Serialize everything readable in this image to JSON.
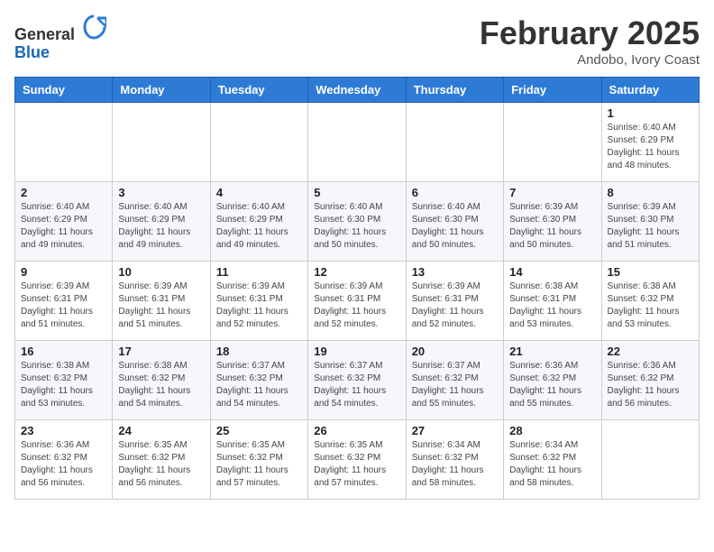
{
  "header": {
    "logo_general": "General",
    "logo_blue": "Blue",
    "month_title": "February 2025",
    "location": "Andobo, Ivory Coast"
  },
  "weekdays": [
    "Sunday",
    "Monday",
    "Tuesday",
    "Wednesday",
    "Thursday",
    "Friday",
    "Saturday"
  ],
  "weeks": [
    [
      {
        "day": "",
        "info": ""
      },
      {
        "day": "",
        "info": ""
      },
      {
        "day": "",
        "info": ""
      },
      {
        "day": "",
        "info": ""
      },
      {
        "day": "",
        "info": ""
      },
      {
        "day": "",
        "info": ""
      },
      {
        "day": "1",
        "info": "Sunrise: 6:40 AM\nSunset: 6:29 PM\nDaylight: 11 hours\nand 48 minutes."
      }
    ],
    [
      {
        "day": "2",
        "info": "Sunrise: 6:40 AM\nSunset: 6:29 PM\nDaylight: 11 hours\nand 49 minutes."
      },
      {
        "day": "3",
        "info": "Sunrise: 6:40 AM\nSunset: 6:29 PM\nDaylight: 11 hours\nand 49 minutes."
      },
      {
        "day": "4",
        "info": "Sunrise: 6:40 AM\nSunset: 6:29 PM\nDaylight: 11 hours\nand 49 minutes."
      },
      {
        "day": "5",
        "info": "Sunrise: 6:40 AM\nSunset: 6:30 PM\nDaylight: 11 hours\nand 50 minutes."
      },
      {
        "day": "6",
        "info": "Sunrise: 6:40 AM\nSunset: 6:30 PM\nDaylight: 11 hours\nand 50 minutes."
      },
      {
        "day": "7",
        "info": "Sunrise: 6:39 AM\nSunset: 6:30 PM\nDaylight: 11 hours\nand 50 minutes."
      },
      {
        "day": "8",
        "info": "Sunrise: 6:39 AM\nSunset: 6:30 PM\nDaylight: 11 hours\nand 51 minutes."
      }
    ],
    [
      {
        "day": "9",
        "info": "Sunrise: 6:39 AM\nSunset: 6:31 PM\nDaylight: 11 hours\nand 51 minutes."
      },
      {
        "day": "10",
        "info": "Sunrise: 6:39 AM\nSunset: 6:31 PM\nDaylight: 11 hours\nand 51 minutes."
      },
      {
        "day": "11",
        "info": "Sunrise: 6:39 AM\nSunset: 6:31 PM\nDaylight: 11 hours\nand 52 minutes."
      },
      {
        "day": "12",
        "info": "Sunrise: 6:39 AM\nSunset: 6:31 PM\nDaylight: 11 hours\nand 52 minutes."
      },
      {
        "day": "13",
        "info": "Sunrise: 6:39 AM\nSunset: 6:31 PM\nDaylight: 11 hours\nand 52 minutes."
      },
      {
        "day": "14",
        "info": "Sunrise: 6:38 AM\nSunset: 6:31 PM\nDaylight: 11 hours\nand 53 minutes."
      },
      {
        "day": "15",
        "info": "Sunrise: 6:38 AM\nSunset: 6:32 PM\nDaylight: 11 hours\nand 53 minutes."
      }
    ],
    [
      {
        "day": "16",
        "info": "Sunrise: 6:38 AM\nSunset: 6:32 PM\nDaylight: 11 hours\nand 53 minutes."
      },
      {
        "day": "17",
        "info": "Sunrise: 6:38 AM\nSunset: 6:32 PM\nDaylight: 11 hours\nand 54 minutes."
      },
      {
        "day": "18",
        "info": "Sunrise: 6:37 AM\nSunset: 6:32 PM\nDaylight: 11 hours\nand 54 minutes."
      },
      {
        "day": "19",
        "info": "Sunrise: 6:37 AM\nSunset: 6:32 PM\nDaylight: 11 hours\nand 54 minutes."
      },
      {
        "day": "20",
        "info": "Sunrise: 6:37 AM\nSunset: 6:32 PM\nDaylight: 11 hours\nand 55 minutes."
      },
      {
        "day": "21",
        "info": "Sunrise: 6:36 AM\nSunset: 6:32 PM\nDaylight: 11 hours\nand 55 minutes."
      },
      {
        "day": "22",
        "info": "Sunrise: 6:36 AM\nSunset: 6:32 PM\nDaylight: 11 hours\nand 56 minutes."
      }
    ],
    [
      {
        "day": "23",
        "info": "Sunrise: 6:36 AM\nSunset: 6:32 PM\nDaylight: 11 hours\nand 56 minutes."
      },
      {
        "day": "24",
        "info": "Sunrise: 6:35 AM\nSunset: 6:32 PM\nDaylight: 11 hours\nand 56 minutes."
      },
      {
        "day": "25",
        "info": "Sunrise: 6:35 AM\nSunset: 6:32 PM\nDaylight: 11 hours\nand 57 minutes."
      },
      {
        "day": "26",
        "info": "Sunrise: 6:35 AM\nSunset: 6:32 PM\nDaylight: 11 hours\nand 57 minutes."
      },
      {
        "day": "27",
        "info": "Sunrise: 6:34 AM\nSunset: 6:32 PM\nDaylight: 11 hours\nand 58 minutes."
      },
      {
        "day": "28",
        "info": "Sunrise: 6:34 AM\nSunset: 6:32 PM\nDaylight: 11 hours\nand 58 minutes."
      },
      {
        "day": "",
        "info": ""
      }
    ]
  ]
}
